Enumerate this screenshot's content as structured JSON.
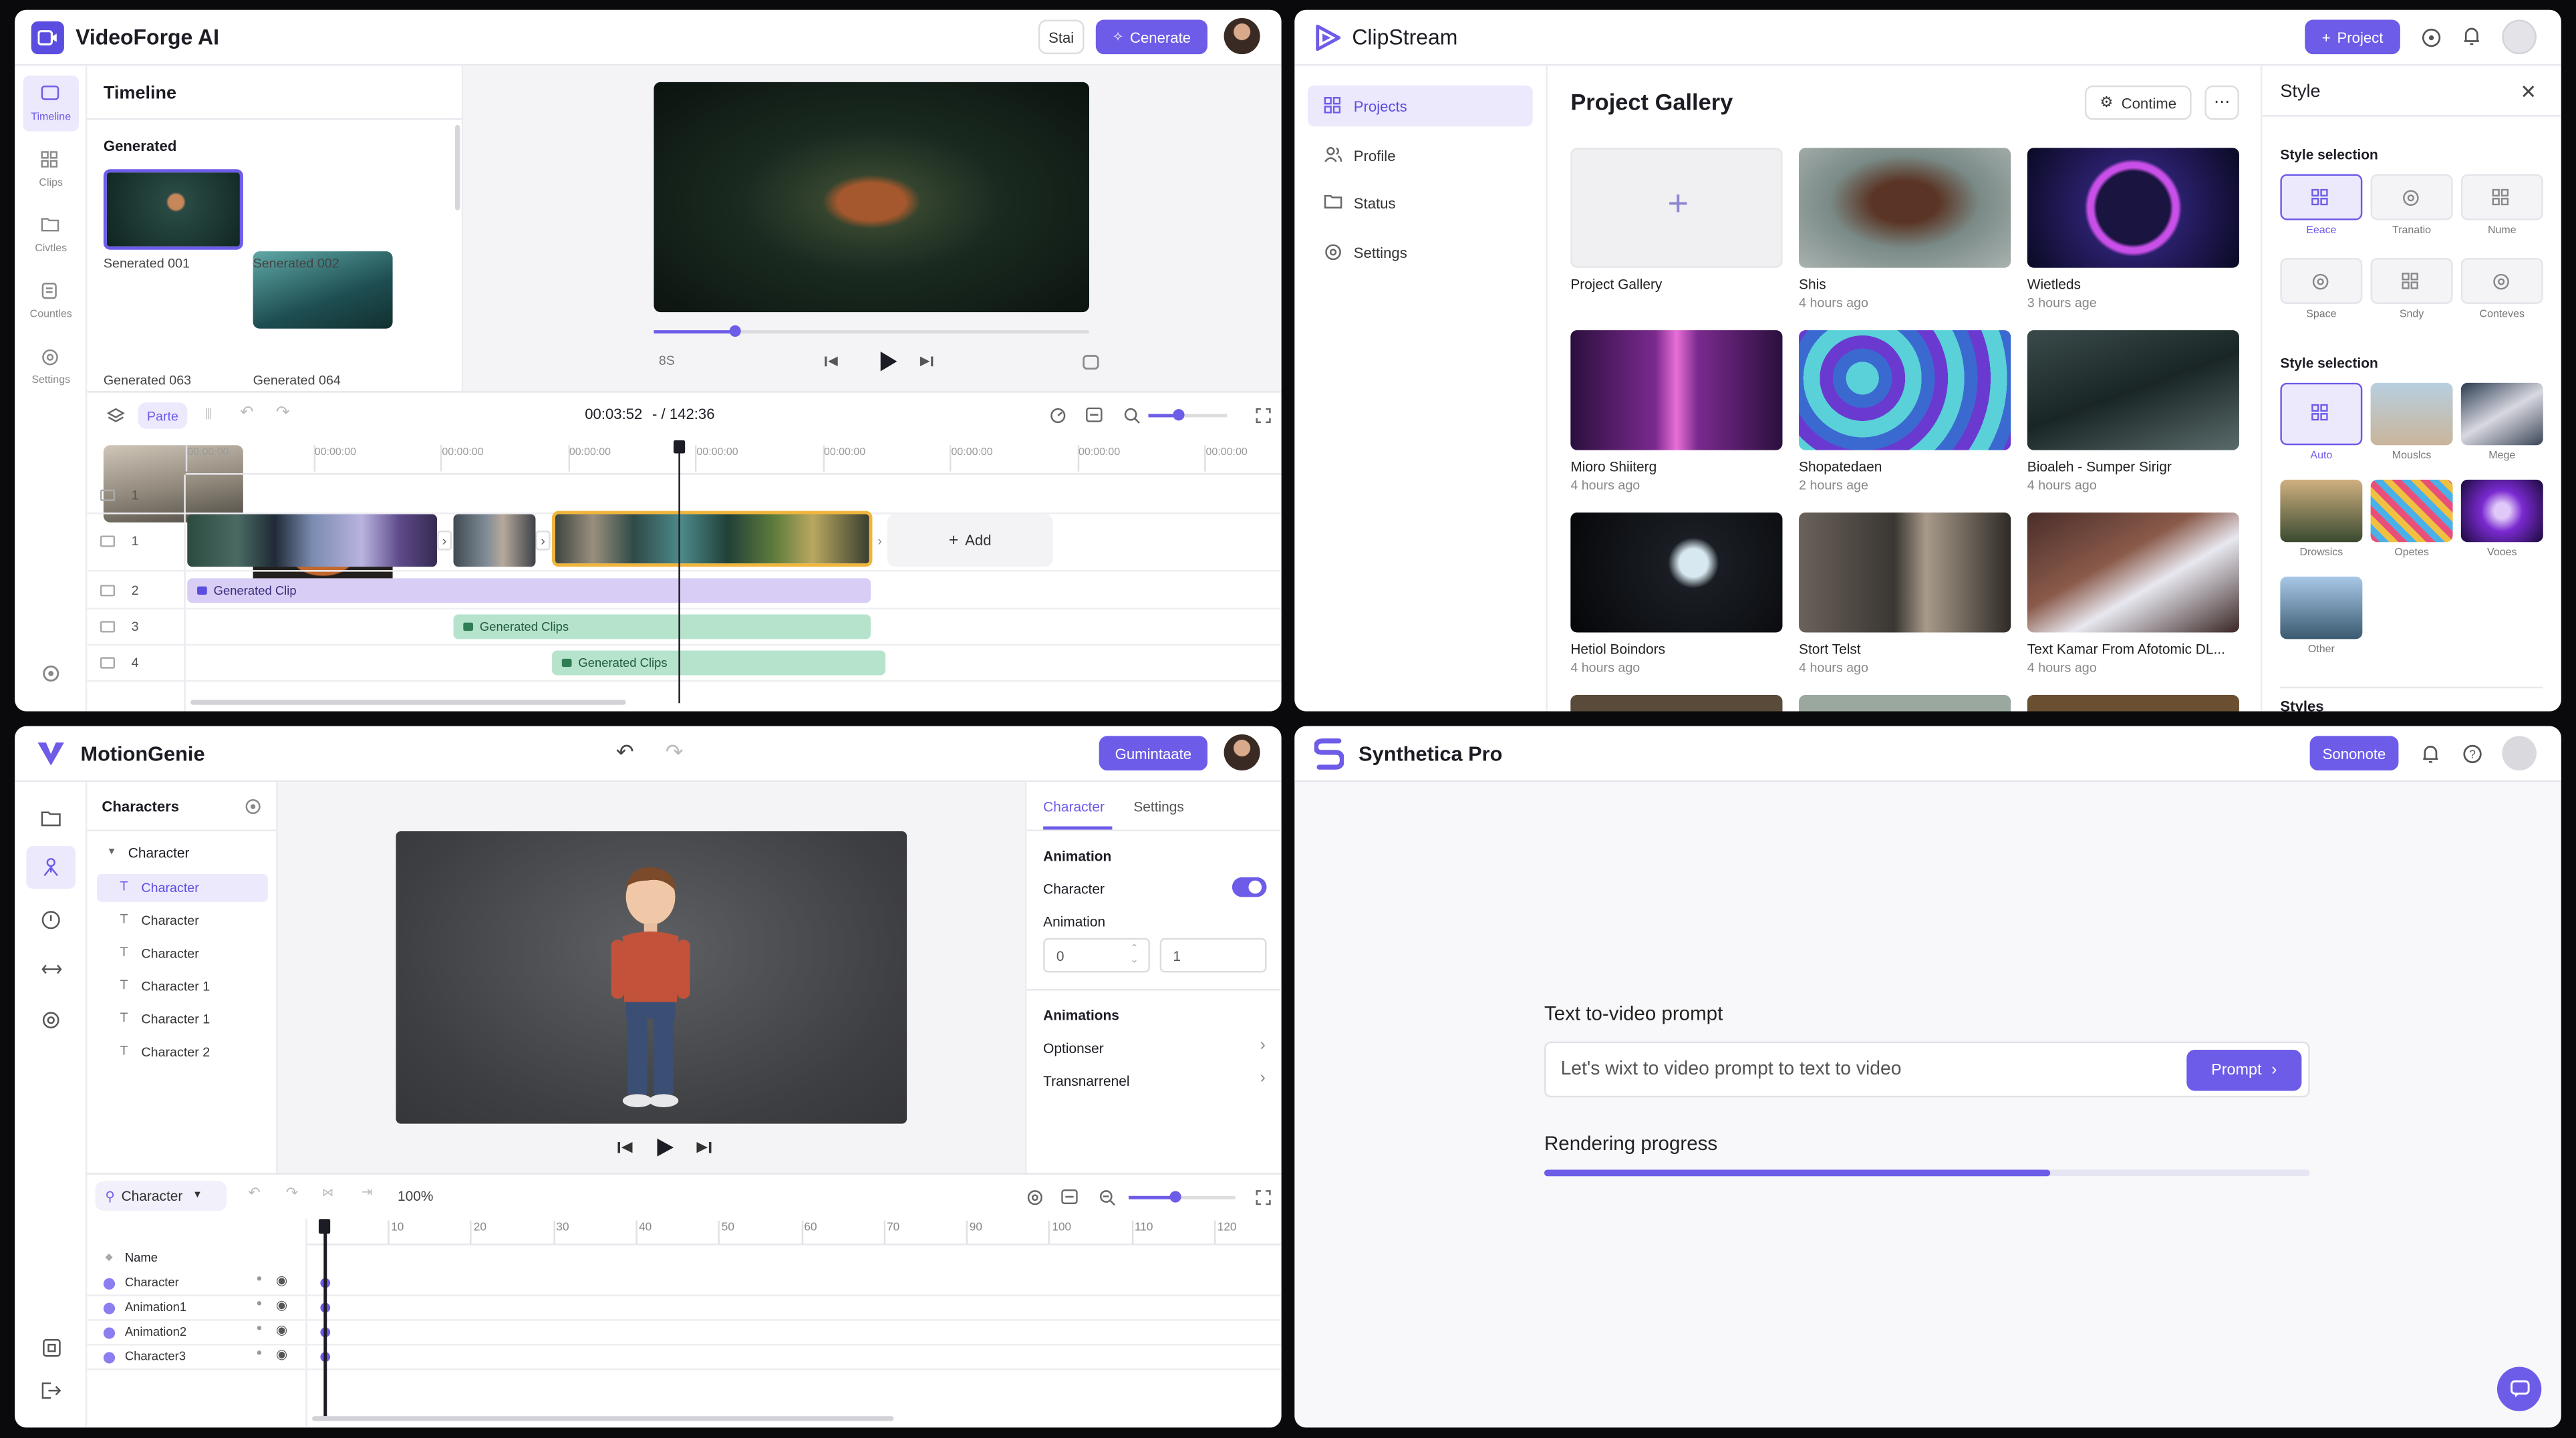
{
  "colors": {
    "accent": "#6d5ce8",
    "accent_light": "#ece9fd",
    "track_purple": "#d8cdf5",
    "track_green": "#b6e3cc",
    "clip_highlight": "#f0b53c",
    "playhead": "#1c1c24"
  },
  "videoforge": {
    "app_title": "VideoForge AI",
    "share_label": "Stai",
    "generate_label": "Cenerate",
    "nav": [
      {
        "label": "Timeline",
        "icon": "timeline-icon"
      },
      {
        "label": "Clips",
        "icon": "grid-icon"
      },
      {
        "label": "Civtles",
        "icon": "folder-icon"
      },
      {
        "label": "Countles",
        "icon": "layers-icon"
      },
      {
        "label": "Settings",
        "icon": "gear-icon"
      }
    ],
    "timeline_title": "Timeline",
    "section_label": "Generated",
    "thumbs": [
      "Senerated 001",
      "Senerated 002",
      "Generated 063",
      "Generated 064"
    ],
    "player_time_left": "8S",
    "toolbar": {
      "paste_label": "Parte",
      "time": "00:03:52",
      "duration": "- / 142:36"
    },
    "ruler": [
      "00:00:00",
      "00:00:00",
      "00:00:00",
      "00:00:00",
      "00:00:00",
      "00:00:00",
      "00:00:00",
      "00:00:00",
      "00:00:00"
    ],
    "track_numbers": [
      "1",
      "1",
      "2",
      "3",
      "4"
    ],
    "add_label": "Add",
    "clip_labels": [
      "Generated Clip",
      "Generated Clips",
      "Generated Clips"
    ]
  },
  "clipstream": {
    "app_title": "ClipStream",
    "project_label": "Project",
    "nav": [
      {
        "label": "Projects",
        "icon": "grid-icon"
      },
      {
        "label": "Profile",
        "icon": "users-icon"
      },
      {
        "label": "Status",
        "icon": "folder-icon"
      },
      {
        "label": "Settings",
        "icon": "gear-icon"
      }
    ],
    "gallery_title": "Project Gallery",
    "continue_label": "Contime",
    "cards": [
      {
        "title": "Project Gallery",
        "sub": ""
      },
      {
        "title": "Shis",
        "sub": "4 hours ago"
      },
      {
        "title": "Wietleds",
        "sub": "3 hours age"
      },
      {
        "title": "Mioro Shiiterg",
        "sub": "4 hours ago"
      },
      {
        "title": "Shopatedaen",
        "sub": "2 hours age"
      },
      {
        "title": "Bioaleh - Sumper Sirigr",
        "sub": "4 hours ago"
      },
      {
        "title": "Hetiol Boindors",
        "sub": "4 hours ago"
      },
      {
        "title": "Stort Telst",
        "sub": "4 hours ago"
      },
      {
        "title": "Text Kamar From Afotomic DL...",
        "sub": "4 hours ago"
      }
    ],
    "style_title": "Style",
    "style_selection_1": "Style selection",
    "style_opts_1": [
      "Eeace",
      "Tranatio",
      "Nume",
      "Space",
      "Sndy",
      "Conteves"
    ],
    "style_selection_2": "Style selection",
    "style_opts_2": [
      "Auto",
      "Mouslcs",
      "Mege",
      "Drowsics",
      "Opetes",
      "Vooes",
      "Other"
    ],
    "styles_label": "Styles"
  },
  "motiongenie": {
    "app_title": "MotionGenie",
    "export_label": "Gumintaate",
    "panel_title": "Characters",
    "tree_root": "Character",
    "tree_items": [
      "Character",
      "Character",
      "Character",
      "Character 1",
      "Character 1",
      "Character 2"
    ],
    "tabs": [
      "Character",
      "Settings"
    ],
    "animation_heading": "Animation",
    "toggle_label": "Character",
    "animation_label": "Animation",
    "field_a": "0",
    "field_b": "1",
    "animations_heading": "Animations",
    "animation_rows": [
      "Optionser",
      "Transnarrenel"
    ],
    "layer_select": "Character",
    "zoom": "100%",
    "ruler": [
      "10",
      "20",
      "30",
      "40",
      "50",
      "60",
      "70",
      "90",
      "100",
      "110",
      "120"
    ],
    "layer_header": "Name",
    "layers": [
      "Character",
      "Animation1",
      "Animation2",
      "Character3"
    ]
  },
  "synthetica": {
    "app_title": "Synthetica Pro",
    "action_label": "Sononote",
    "prompt_label": "Text to-video prompt",
    "prompt_value": "Let's wixt to video prompt to text to video",
    "prompt_button": "Prompt",
    "progress_label": "Rendering progress",
    "progress": 0.66
  }
}
